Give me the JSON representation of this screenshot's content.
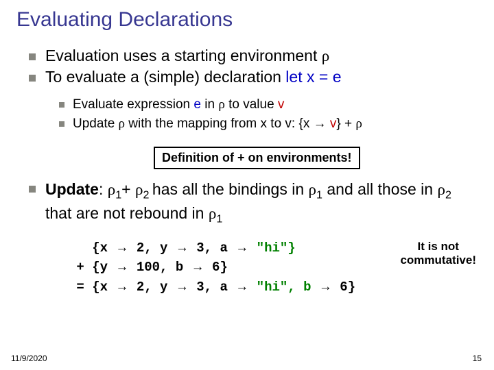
{
  "title": "Evaluating Declarations",
  "bullets_l1": [
    {
      "pre": "Evaluation uses a starting environment ",
      "rho": "ρ"
    },
    {
      "pre": "To evaluate a (simple) declaration ",
      "code": "let x = e"
    }
  ],
  "bullets_l2": [
    {
      "t1": "Evaluate expression ",
      "e": "e",
      "t2": " in ",
      "rho": "ρ",
      "t3": " to value ",
      "v": "v"
    },
    {
      "t1": "Update ",
      "rho": "ρ",
      "t2": " with the mapping from x to v:  {x ",
      "arr": "→",
      "t3": " ",
      "v": "v",
      "t4": "} + ",
      "rho2": "ρ"
    }
  ],
  "def_box": "Definition of + on environments!",
  "update": {
    "label": "Update",
    "t1": ": ",
    "r1": "ρ",
    "s1": "1",
    "plus": "+ ",
    "r2": "ρ",
    "s2": "2 ",
    "t2": "has all the bindings in ",
    "r3": "ρ",
    "s3": "1",
    "t3": " and all those in ",
    "r4": "ρ",
    "s4": "2  ",
    "t4": "that are not rebound in ",
    "r5": "ρ",
    "s5": "1"
  },
  "note": {
    "l1": "It is not",
    "l2": "commutative!"
  },
  "mono": {
    "row1_pre": "   {x ",
    "arr": "→",
    "row1_mid": " 2, y ",
    "row1_mid2": " 3, a ",
    "row1_end": " \"hi\"}",
    "row2_pre": " + {y ",
    "row2_mid": " 100, b ",
    "row2_end": " 6}",
    "row3_pre": " = {x ",
    "row3_m1": " 2, y ",
    "row3_m2": " 3, a ",
    "row3_m3": " \"hi\", b ",
    "row3_end": " 6}"
  },
  "footer": {
    "date": "11/9/2020",
    "num": "15"
  }
}
